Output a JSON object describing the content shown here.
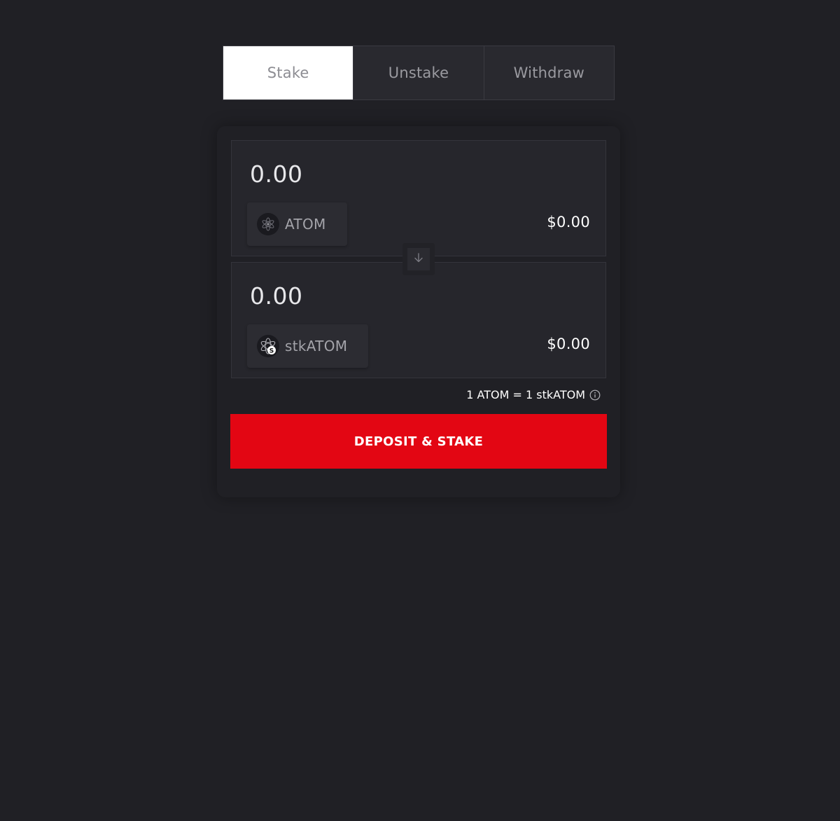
{
  "tabs": [
    {
      "label": "Stake",
      "active": true
    },
    {
      "label": "Unstake",
      "active": false
    },
    {
      "label": "Withdraw",
      "active": false
    }
  ],
  "from": {
    "amount": "0.00",
    "token": "ATOM",
    "token_icon": "atom-icon",
    "usd_value": "$0.00"
  },
  "to": {
    "amount": "0.00",
    "token": "stkATOM",
    "token_icon": "stkatom-icon",
    "usd_value": "$0.00"
  },
  "swap_icon": "arrow-down-icon",
  "rate": {
    "text": "1 ATOM = 1 stkATOM",
    "icon": "info-icon"
  },
  "action": {
    "label": "DEPOSIT & STAKE"
  },
  "colors": {
    "background": "#202025",
    "primary": "#e30613",
    "tab_active_bg": "#ffffff"
  }
}
